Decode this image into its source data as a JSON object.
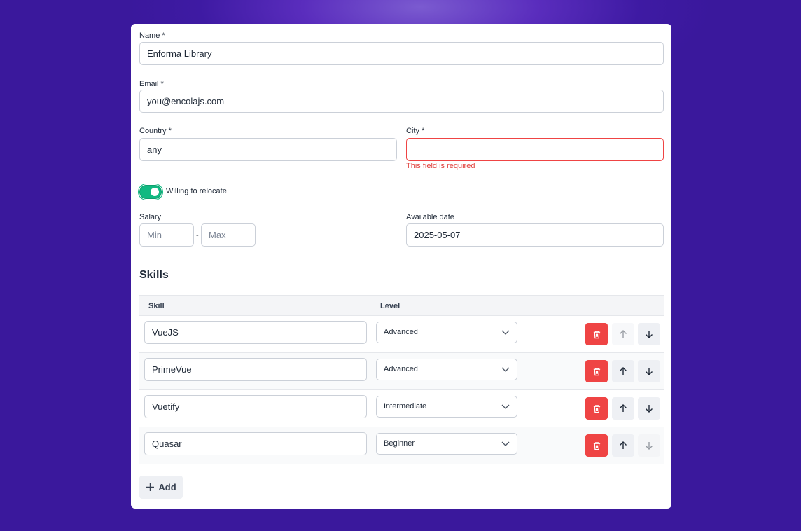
{
  "form": {
    "name": {
      "label": "Name *",
      "value": "Enforma Library"
    },
    "email": {
      "label": "Email *",
      "value": "you@encolajs.com"
    },
    "country": {
      "label": "Country *",
      "value": "any"
    },
    "city": {
      "label": "City *",
      "value": "",
      "error": "This field is required"
    },
    "relocate": {
      "label": "Willing to relocate",
      "checked": true
    },
    "salary": {
      "label": "Salary",
      "min_placeholder": "Min",
      "max_placeholder": "Max",
      "separator": "-"
    },
    "available_date": {
      "label": "Available date",
      "value": "2025-05-07"
    }
  },
  "skills": {
    "title": "Skills",
    "columns": {
      "skill": "Skill",
      "level": "Level"
    },
    "rows": [
      {
        "skill": "VueJS",
        "level": "Advanced"
      },
      {
        "skill": "PrimeVue",
        "level": "Advanced"
      },
      {
        "skill": "Vuetify",
        "level": "Intermediate"
      },
      {
        "skill": "Quasar",
        "level": "Beginner"
      }
    ],
    "add_label": "Add"
  },
  "icons": {
    "delete": "trash-icon",
    "up": "arrow-up-icon",
    "down": "arrow-down-icon",
    "add": "plus-icon",
    "select": "chevron-down-icon"
  },
  "colors": {
    "accent": "#10b981",
    "danger": "#ef4444",
    "background": "#3e1aa3"
  }
}
